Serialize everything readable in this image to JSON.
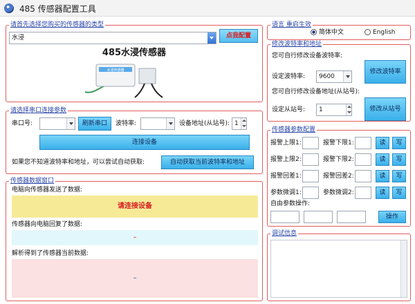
{
  "window": {
    "title": "485 传感器配置工具"
  },
  "sensor_select": {
    "legend": "请首先选择您购买的传感器的类型",
    "selected": "水浸",
    "button": "点我配置",
    "sensor_name": "485水浸传感器",
    "device_caption": "水浸传感器"
  },
  "serial": {
    "legend": "请选择串口连接参数",
    "port_label": "串口号:",
    "refresh_button": "刷新串口",
    "baud_label": "波特率:",
    "addr_label": "设备地址(从站号):",
    "addr_value": "1",
    "connect_button": "连接设备",
    "hint": "如果您不知道波特率和地址，可以尝试自动获取:",
    "auto_button": "自动获取当前波特率和地址"
  },
  "data_window": {
    "legend": "传感器数据窗口",
    "sent_label": "电脑向传感器发送了数据:",
    "sent_message": "请连接设备",
    "reply_label": "传感器向电脑回复了数据:",
    "reply_value": "–",
    "parsed_label": "解析得到了传感器当前数据:",
    "parsed_value": "–"
  },
  "language": {
    "legend": "语言 重启生效",
    "options": [
      "简体中文",
      "English"
    ],
    "selected": "简体中文"
  },
  "baud_addr": {
    "legend": "修改波特率和地址",
    "baud_hint": "您可自行修改设备波特率:",
    "baud_label": "设定波特率:",
    "baud_value": "9600",
    "baud_button": "修改波特率",
    "addr_hint": "您可自行修改设备地址(从站号):",
    "addr_label": "设定从站号:",
    "addr_value": "1",
    "addr_button": "修改从站号"
  },
  "params": {
    "legend": "传感器参数配置",
    "fields": [
      "报警上限1:",
      "报警下限1:",
      "报警上限2:",
      "报警下限2:",
      "报警回差1:",
      "报警回差2:",
      "参数微调1:",
      "参数微调2:"
    ],
    "read_button": "读",
    "write_button": "写",
    "custom_label": "自由参数操作:",
    "operate_button": "操作"
  },
  "debug": {
    "legend": "调试信息"
  },
  "colors": {
    "frame_border": "#e25c5c",
    "legend_text": "#2b47a8",
    "sent_bg": "#f6ea97",
    "reply_bg": "#e2f7fb",
    "parsed_bg": "#fbe1e1",
    "highlight_text": "#d82020"
  }
}
